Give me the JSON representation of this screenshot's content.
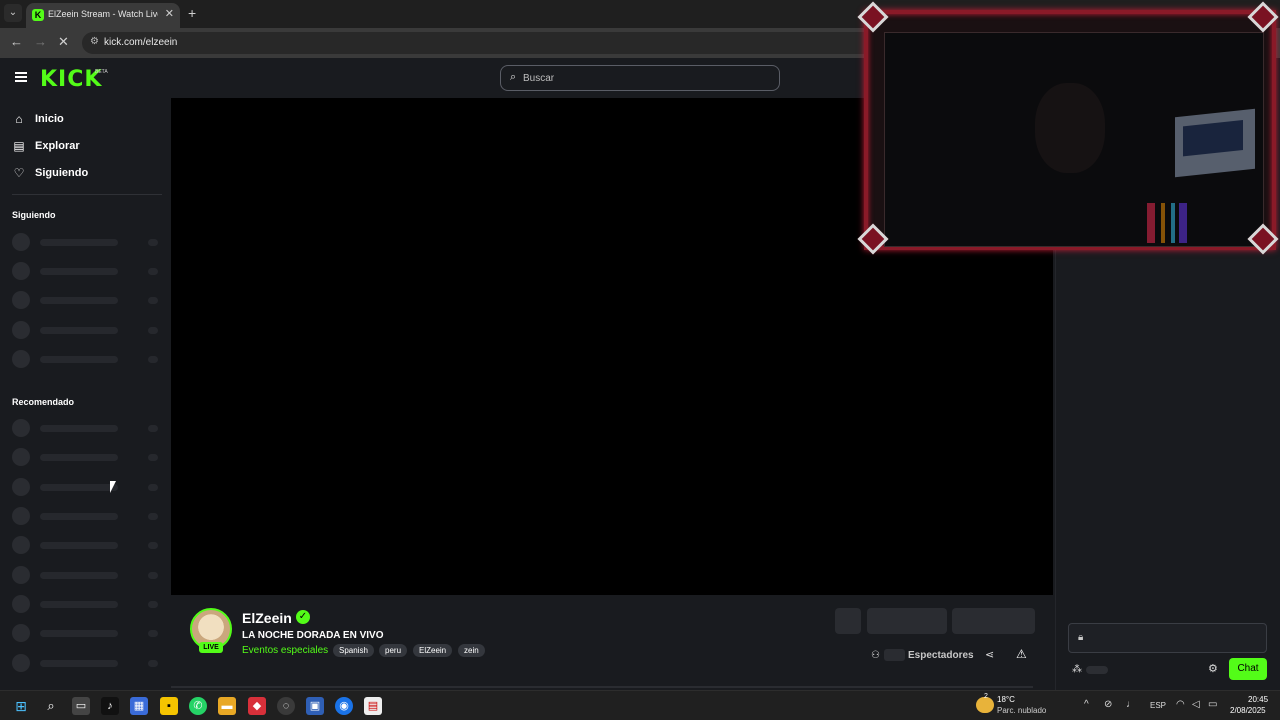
{
  "browser": {
    "tab_title": "ElZeein Stream - Watch Live on",
    "tab_favicon": "K",
    "tab_close": "✕",
    "new_tab": "+",
    "url": "kick.com/elzeein"
  },
  "header": {
    "logo": "KICK",
    "logo_badge": "BETA",
    "search_placeholder": "Buscar"
  },
  "sidebar": {
    "nav": [
      {
        "label": "Inicio",
        "icon": "home-icon"
      },
      {
        "label": "Explorar",
        "icon": "browse-icon"
      },
      {
        "label": "Siguiendo",
        "icon": "heart-icon"
      }
    ],
    "following_title": "Siguiendo",
    "recommended_title": "Recomendado"
  },
  "channel": {
    "name": "ElZeein",
    "live_badge": "LIVE",
    "stream_title": "LA NOCHE DORADA EN VIVO",
    "category": "Eventos especiales",
    "tags": [
      "Spanish",
      "peru",
      "ElZeein",
      "zein"
    ],
    "viewers_label": "Espectadores"
  },
  "chat": {
    "send_label": "Chat"
  },
  "taskbar": {
    "weather_temp": "18°C",
    "weather_desc": "Parc. nublado",
    "weather_badge": "2",
    "language": "ESP",
    "time": "20:45",
    "date": "2/08/2025"
  },
  "colors": {
    "accent": "#53fc18",
    "background": "#191b1f",
    "frame": "#8a1a28"
  }
}
